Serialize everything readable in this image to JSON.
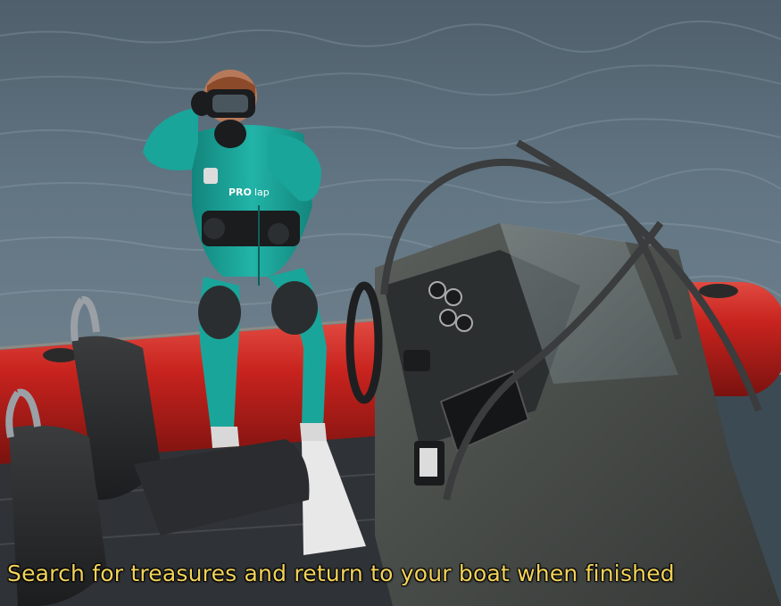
{
  "hud": {
    "objective_text": "Search for treasures and return to your boat when finished",
    "objective_color": "#f3d35a"
  },
  "scene": {
    "suit_brand": "PRO",
    "suit_brand_suffix": "lap",
    "water_color": "#5b6d7a",
    "tube_color": "#c8231e",
    "suit_color": "#1aa59a",
    "console_color": "#4b4f4c"
  }
}
